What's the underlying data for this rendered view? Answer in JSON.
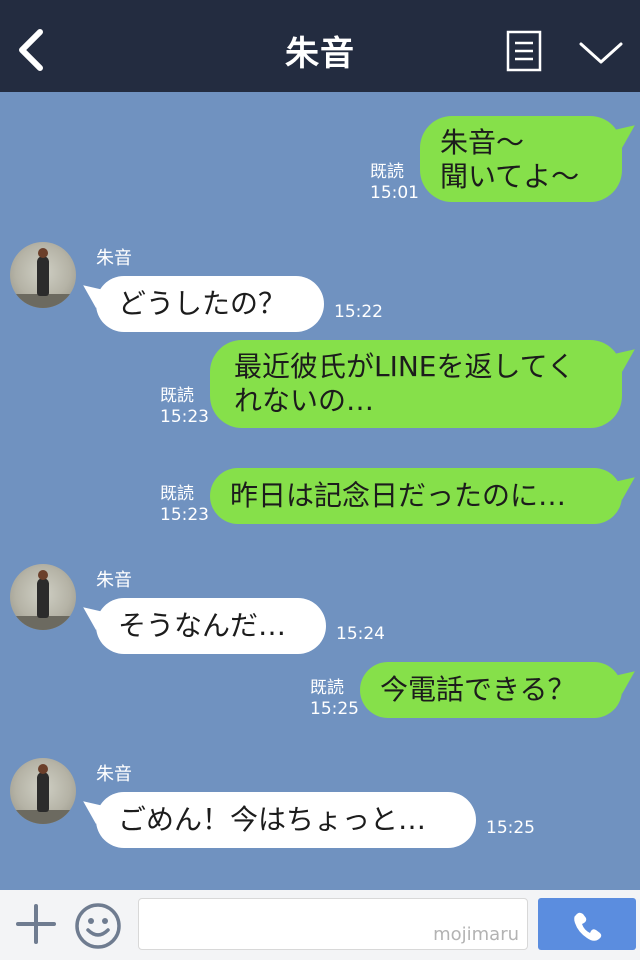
{
  "header": {
    "title": "朱音"
  },
  "messages": [
    {
      "from": "me",
      "text": "朱音〜\n聞いてよ〜",
      "read": "既読",
      "time": "15:01"
    },
    {
      "from": "them",
      "sender": "朱音",
      "text": "どうしたの？",
      "time": "15:22"
    },
    {
      "from": "me",
      "text": "最近彼氏がLINEを返してく\nれないの…",
      "read": "既読",
      "time": "15:23"
    },
    {
      "from": "me",
      "text": "昨日は記念日だったのに…",
      "read": "既読",
      "time": "15:23"
    },
    {
      "from": "them",
      "sender": "朱音",
      "text": "そうなんだ…",
      "time": "15:24"
    },
    {
      "from": "me",
      "text": "今電話できる？",
      "read": "既読",
      "time": "15:25"
    },
    {
      "from": "them",
      "sender": "朱音",
      "text": "ごめん！今はちょっと…",
      "time": "15:25"
    }
  ],
  "footer": {
    "watermark": "mojimaru"
  },
  "colors": {
    "header": "#232c40",
    "chat_bg": "#7092c0",
    "my_bubble": "#86e04a",
    "their_bubble": "#ffffff",
    "call_button": "#5b8ddf"
  },
  "icons": [
    "back-arrow-icon",
    "menu-icon",
    "chevron-down-icon",
    "plus-icon",
    "smile-icon",
    "phone-icon"
  ]
}
